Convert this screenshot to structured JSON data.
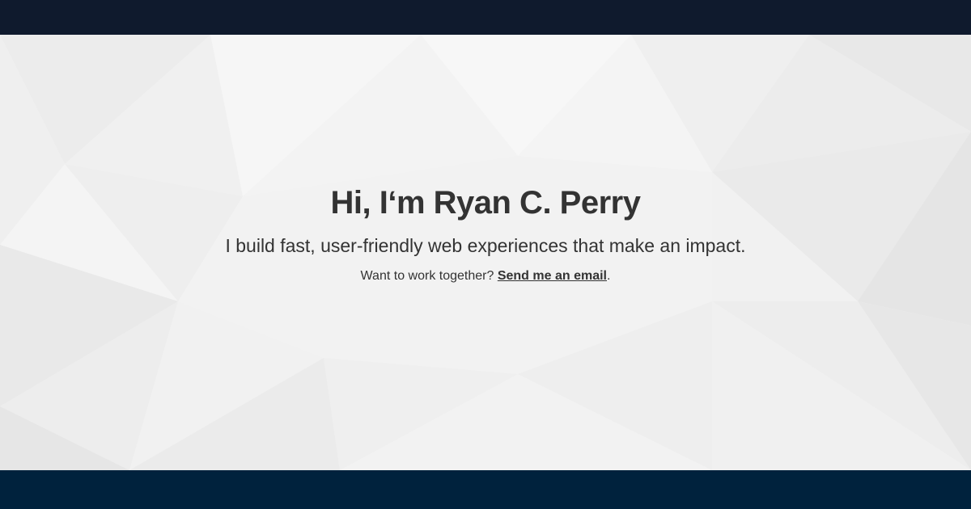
{
  "hero": {
    "title": "Hi, I‘m Ryan C. Perry",
    "subtitle": "I build fast, user-friendly web experiences that make an impact.",
    "cta_prefix": "Want to work together? ",
    "cta_link": "Send me an email",
    "cta_suffix": "."
  },
  "colors": {
    "top_bar": "#0f1a2d",
    "bottom_bar": "#00223d",
    "text": "#333333",
    "background": "#f2f2f2"
  }
}
